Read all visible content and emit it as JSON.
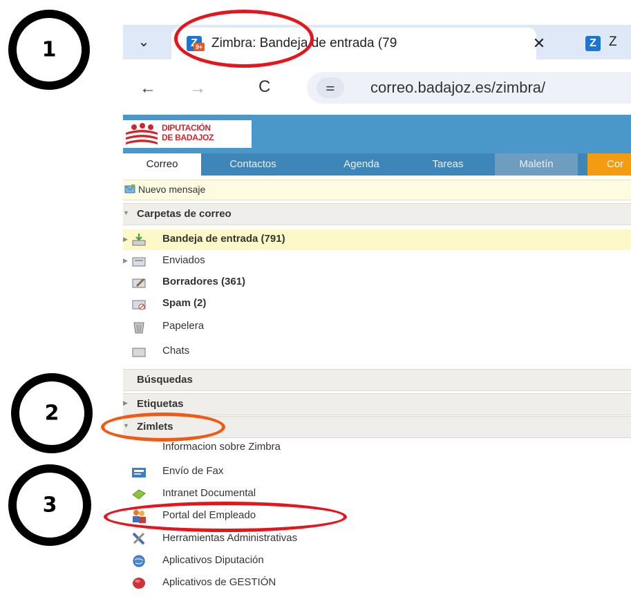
{
  "browser": {
    "active_tab": {
      "title": "Zimbra: Bandeja de entrada (79",
      "favicon": "zimbra-icon",
      "badge": "9+"
    },
    "second_tab": {
      "title": "Z",
      "favicon": "zimbra-icon"
    },
    "url": "correo.badajoz.es/zimbra/",
    "icons": {
      "back": "←",
      "forward": "→",
      "reload": "C",
      "dropdown": "⌄",
      "close": "✕",
      "site_info": "⚌"
    }
  },
  "app": {
    "logo_line1": "DIPUTACIÓN",
    "logo_line2": "DE BADAJOZ",
    "tabs": [
      {
        "label": "Correo"
      },
      {
        "label": "Contactos"
      },
      {
        "label": "Agenda"
      },
      {
        "label": "Tareas"
      },
      {
        "label": "Maletín"
      },
      {
        "label": "Cor"
      }
    ],
    "toolbar": {
      "new_message": "Nuevo mensaje"
    },
    "mail_folders": {
      "header": "Carpetas de correo",
      "items": [
        {
          "label": "Bandeja de entrada (791)",
          "bold": true,
          "icon": "inbox-icon"
        },
        {
          "label": "Enviados",
          "bold": false,
          "icon": "sent-icon"
        },
        {
          "label": "Borradores (361)",
          "bold": true,
          "icon": "drafts-icon"
        },
        {
          "label": "Spam (2)",
          "bold": true,
          "icon": "spam-icon"
        },
        {
          "label": "Papelera",
          "bold": false,
          "icon": "trash-icon"
        },
        {
          "label": "Chats",
          "bold": false,
          "icon": "chats-folder-icon"
        }
      ]
    },
    "searches_header": "Búsquedas",
    "tags_header": "Etiquetas",
    "zimlets": {
      "header": "Zimlets",
      "items": [
        {
          "label": "Informacion sobre Zimbra"
        },
        {
          "label": "Envío de Fax"
        },
        {
          "label": "Intranet Documental"
        },
        {
          "label": "Portal del Empleado"
        },
        {
          "label": "Herramientas Administrativas"
        },
        {
          "label": "Aplicativos Diputación"
        },
        {
          "label": "Aplicativos de GESTIÓN"
        }
      ]
    }
  },
  "annotations": {
    "step1": "1",
    "step2": "2",
    "step3": "3",
    "circle_color_red": "#e8141c",
    "circle_color_orange": "#f05a14"
  }
}
